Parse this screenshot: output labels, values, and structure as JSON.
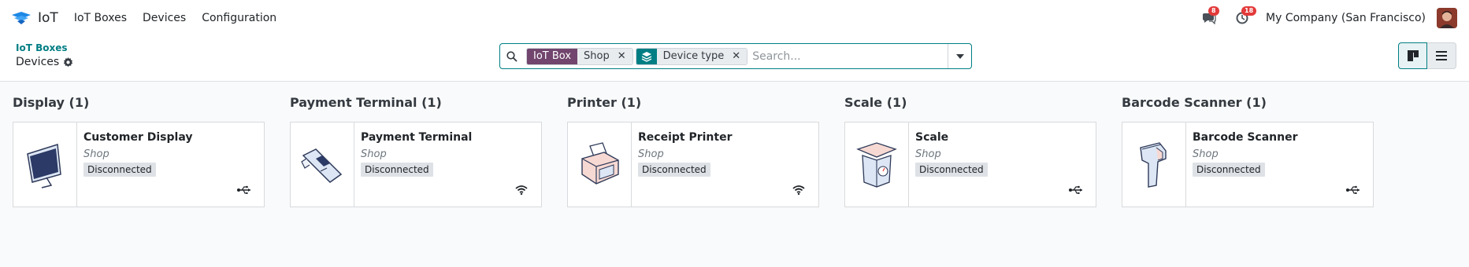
{
  "app": {
    "name": "IoT"
  },
  "menu": [
    "IoT Boxes",
    "Devices",
    "Configuration"
  ],
  "systray": {
    "messages_count": "8",
    "activities_count": "18",
    "company": "My Company (San Francisco)"
  },
  "breadcrumb": {
    "parent": "IoT Boxes",
    "current": "Devices"
  },
  "search": {
    "facets": [
      {
        "label": "IoT Box",
        "value": "Shop"
      },
      {
        "icon": "layers-icon",
        "value": "Device type"
      }
    ],
    "placeholder": "Search..."
  },
  "columns": [
    {
      "title": "Display (1)",
      "card": {
        "name": "Customer Display",
        "location": "Shop",
        "status": "Disconnected",
        "connection": "usb-icon"
      }
    },
    {
      "title": "Payment Terminal (1)",
      "card": {
        "name": "Payment Terminal",
        "location": "Shop",
        "status": "Disconnected",
        "connection": "wifi-icon"
      }
    },
    {
      "title": "Printer (1)",
      "card": {
        "name": "Receipt Printer",
        "location": "Shop",
        "status": "Disconnected",
        "connection": "wifi-icon"
      }
    },
    {
      "title": "Scale (1)",
      "card": {
        "name": "Scale",
        "location": "Shop",
        "status": "Disconnected",
        "connection": "usb-icon"
      }
    },
    {
      "title": "Barcode Scanner (1)",
      "card": {
        "name": "Barcode Scanner",
        "location": "Shop",
        "status": "Disconnected",
        "connection": "usb-icon"
      }
    }
  ],
  "colors": {
    "accent": "#017e84",
    "facet_purple": "#71456d",
    "badge_red": "#e33a3a"
  }
}
